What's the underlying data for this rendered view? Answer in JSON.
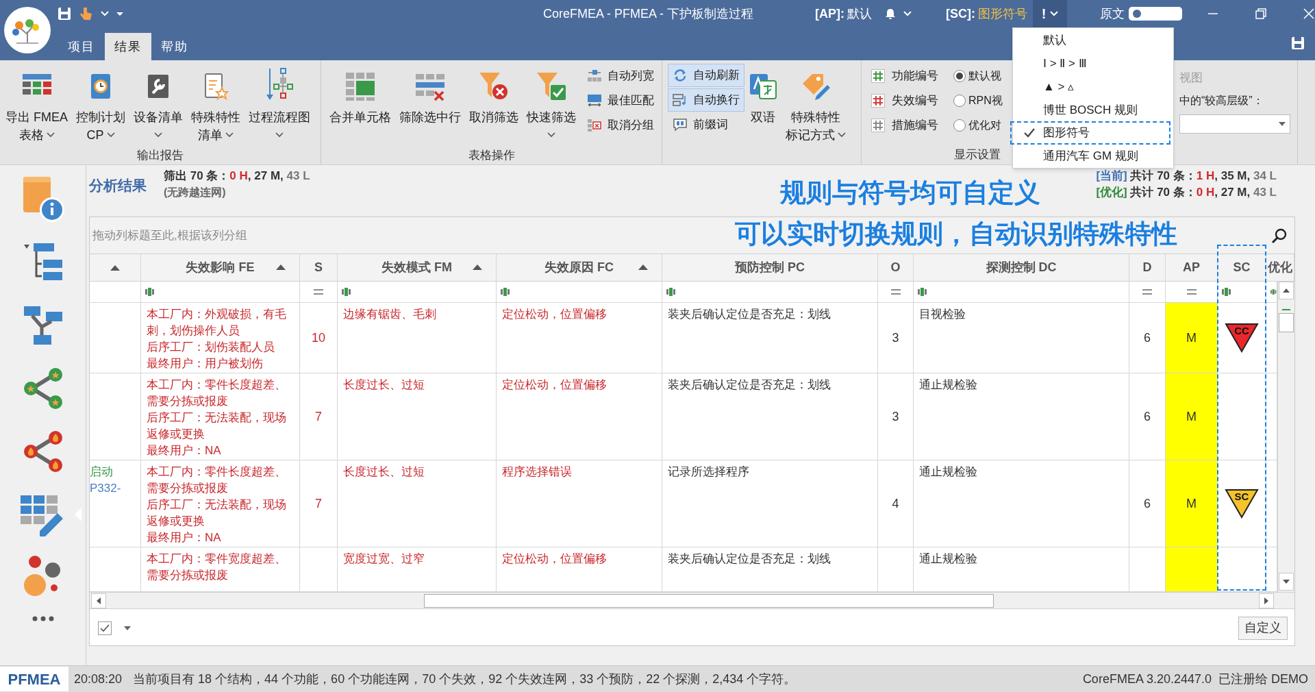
{
  "title_bar": {
    "title": "CoreFMEA - PFMEA - 下护板制造过程",
    "ap_label": "[AP]:",
    "ap_value": "默认",
    "sc_label": "[SC]:",
    "sc_value": "图形符号",
    "sc_button": "!",
    "source_label": "原文",
    "source_on": false
  },
  "menu_tabs": [
    {
      "label": "项目",
      "selected": false
    },
    {
      "label": "结果",
      "selected": true
    },
    {
      "label": "帮助",
      "selected": false
    }
  ],
  "ribbon": {
    "output_group": {
      "label": "输出报告",
      "buttons": [
        {
          "lines": [
            "导出 FMEA",
            "表格"
          ],
          "dropdown": true
        },
        {
          "lines": [
            "控制计划",
            "CP"
          ],
          "dropdown": true
        },
        {
          "lines": [
            "设备清单"
          ],
          "dropdown": true
        },
        {
          "lines": [
            "特殊特性",
            "清单"
          ],
          "dropdown": true
        },
        {
          "lines": [
            "过程流程图"
          ],
          "dropdown": true
        }
      ]
    },
    "table_group": {
      "label": "表格操作",
      "buttons": [
        {
          "lines": [
            "合并单元格"
          ],
          "dropdown": false
        },
        {
          "lines": [
            "筛除选中行"
          ],
          "dropdown": false
        },
        {
          "lines": [
            "取消筛选"
          ],
          "dropdown": false
        },
        {
          "lines": [
            "快速筛选"
          ],
          "dropdown": true
        }
      ],
      "small_buttons": [
        {
          "label": "自动列宽"
        },
        {
          "label": "最佳匹配"
        },
        {
          "label": "取消分组"
        }
      ]
    },
    "view_group": {
      "toggles": [
        {
          "label": "自动刷新",
          "on": true
        },
        {
          "label": "自动换行",
          "on": true
        },
        {
          "label": "前缀词",
          "on": false
        }
      ],
      "buttons": [
        {
          "lines": [
            "双语"
          ],
          "dropdown": false
        },
        {
          "lines": [
            "特殊特性",
            "标记方式"
          ],
          "dropdown": true
        }
      ]
    },
    "display_group": {
      "label": "显示设置",
      "numbering": [
        {
          "label": "功能编号",
          "color": "#3c9a3c"
        },
        {
          "label": "失效编号",
          "color": "#d23c3c"
        },
        {
          "label": "措施编号",
          "color": "#8a8a8a"
        }
      ],
      "views": [
        {
          "label": "默认视",
          "selected": true
        },
        {
          "label": "RPN视",
          "selected": false
        },
        {
          "label": "优化对",
          "selected": false
        }
      ],
      "option_label": "视图",
      "option_disabled": true,
      "level_label": "中的“较高层级”："
    }
  },
  "sc_menu": {
    "items": [
      {
        "label": "默认",
        "checked": false
      },
      {
        "label": "Ⅰ > Ⅱ > Ⅲ",
        "checked": false
      },
      {
        "label": "▲ > ▵",
        "checked": false
      },
      {
        "label": "博世 BOSCH 规则",
        "checked": false
      },
      {
        "label": "图形符号",
        "checked": true
      },
      {
        "label": "通用汽车 GM 规则",
        "checked": false
      }
    ]
  },
  "sidebar": {
    "items": [
      {
        "selected": false
      },
      {
        "selected": false
      },
      {
        "selected": false
      },
      {
        "selected": false
      },
      {
        "selected": false
      },
      {
        "selected": true
      },
      {
        "selected": false
      },
      {
        "selected": false
      }
    ]
  },
  "summary": {
    "title": "分析结果",
    "filtered": [
      {
        "text": "筛出 70 条：",
        "color": "#333333"
      },
      {
        "text": "0 H",
        "color": "#d0282c"
      },
      {
        "text": ", 27 M, ",
        "color": "#333333"
      },
      {
        "text": "43 L",
        "color": "#777777"
      }
    ],
    "note": "(无跨越连网)",
    "current": [
      {
        "text": "[当前]",
        "color": "#3f6fb5"
      },
      {
        "text": " 共计 70 条：",
        "color": "#333333"
      },
      {
        "text": "1 H",
        "color": "#d0282c"
      },
      {
        "text": ", 35 M, ",
        "color": "#333333"
      },
      {
        "text": "34 L",
        "color": "#777777"
      }
    ],
    "optimized": [
      {
        "text": "[优化]",
        "color": "#2f8a3a"
      },
      {
        "text": " 共计 70 条：",
        "color": "#333333"
      },
      {
        "text": "0 H",
        "color": "#d0282c"
      },
      {
        "text": ", 27 M, ",
        "color": "#333333"
      },
      {
        "text": "43 L",
        "color": "#777777"
      }
    ]
  },
  "annotations": [
    "规则与符号均可自定义",
    "可以实时切换规则，自动识别特殊特性"
  ],
  "grid": {
    "group_hint": "拖动列标题至此,根据该列分组",
    "columns": [
      {
        "sorted": true
      },
      {
        "label": "失效影响 FE",
        "sorted": true,
        "kind": "text"
      },
      {
        "label": "S",
        "kind": "number"
      },
      {
        "label": "失效模式 FM",
        "sorted": true,
        "kind": "text"
      },
      {
        "label": "失效原因 FC",
        "sorted": true,
        "kind": "text"
      },
      {
        "label": "预防控制 PC",
        "kind": "text"
      },
      {
        "label": "O",
        "kind": "number"
      },
      {
        "label": "探测控制 DC",
        "kind": "text"
      },
      {
        "label": "D",
        "kind": "number"
      },
      {
        "label": "AP",
        "kind": "number"
      },
      {
        "label": "SC",
        "kind": "text"
      },
      {
        "label": "优化",
        "kind": "text"
      }
    ],
    "rows": [
      {
        "fe": [
          "本工厂内：外观破损，有毛刺，划伤操作人员",
          "后序工厂：划伤装配人员",
          "最终用户：用户被划伤"
        ],
        "s": "10",
        "fm": "边缘有锯齿、毛刺",
        "fc": "定位松动，位置偏移",
        "pc": "装夹后确认定位是否充足：划线",
        "o": "3",
        "dc": "目视检验",
        "d": "6",
        "ap": {
          "text": "M",
          "color": "#ffff00"
        },
        "sc": {
          "kind": "critical",
          "text": "CC"
        }
      },
      {
        "fe": [
          "本工厂内：零件长度超差、需要分拣或报废",
          "后序工厂：无法装配，现场返修或更换",
          "最终用户：NA"
        ],
        "s": "7",
        "fm": "长度过长、过短",
        "fc": "定位松动，位置偏移",
        "pc": "装夹后确认定位是否充足：划线",
        "o": "3",
        "dc": "通止规检验",
        "d": "6",
        "ap": {
          "text": "M",
          "color": "#ffff00"
        }
      },
      {
        "lead": [
          {
            "text": "启动",
            "color": "#3a9a4a"
          },
          {
            "text": "P332-",
            "color": "#4a7fc0"
          }
        ],
        "fe": [
          "本工厂内：零件长度超差、需要分拣或报废",
          "后序工厂：无法装配，现场返修或更换",
          "最终用户：NA"
        ],
        "s": "7",
        "fm": "长度过长、过短",
        "fc": "程序选择错误",
        "pc": "记录所选择程序",
        "o": "4",
        "dc": "通止规检验",
        "d": "6",
        "ap": {
          "text": "M",
          "color": "#ffff00"
        },
        "sc": {
          "kind": "significant",
          "text": "SC"
        }
      },
      {
        "fe": [
          "本工厂内：零件宽度超差、需要分拣或报废"
        ],
        "fm": "宽度过宽、过窄",
        "fc": "定位松动，位置偏移",
        "pc": "装夹后确认定位是否充足：划线",
        "dc": "通止规检验",
        "ap": {
          "color": "#ffff00"
        }
      }
    ]
  },
  "footer": {
    "filter_checked": true,
    "customize_button": "自定义"
  },
  "status_bar": {
    "mode": "PFMEA",
    "time": "20:08:20",
    "message": "当前项目有 18 个结构，44 个功能，60 个功能连网，70 个失效，92 个失效连网，33 个预防，22 个探测，2,434 个字符。",
    "version": "CoreFMEA 3.20.2447.0  已注册给 DEMO"
  }
}
